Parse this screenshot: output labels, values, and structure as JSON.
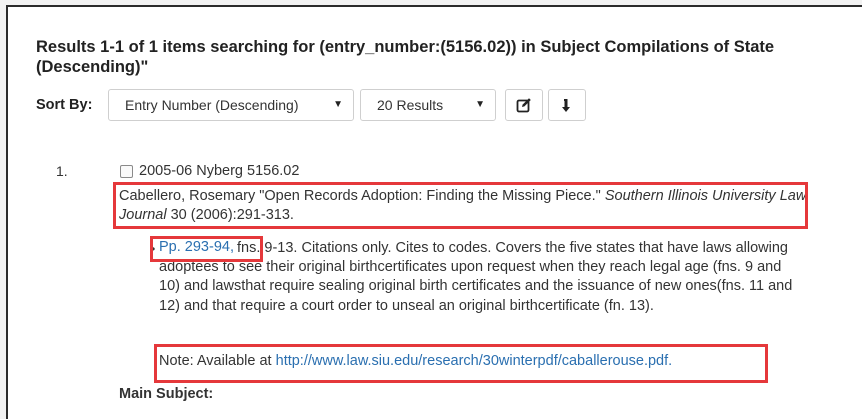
{
  "results": {
    "heading_line1": "Results 1-1 of 1 items searching for (entry_number:(5156.02)) in Subject Compilations of State",
    "heading_line2": "(Descending)\""
  },
  "toolbar": {
    "sort_label": "Sort By:",
    "sort_value": "Entry Number (Descending)",
    "count_value": "20 Results",
    "caret_glyph": "▼",
    "edit_icon": "edit-icon",
    "sort_icon": "sort-arrow-icon"
  },
  "entry": {
    "number": "1.",
    "title": "2005-06 Nyberg 5156.02",
    "citation_author": "Cabellero, Rosemary  \"Open Records Adoption: Finding the Missing Piece.\"  ",
    "citation_journal": "Southern Illinois University Law Journal",
    "citation_tail": "  30 (2006):291-313.",
    "pages": "Pp. 293-94,",
    "description": "fns. 9-13. Citations only. Cites to codes. Covers the five states that have laws allowing adoptees to see their original birthcertificates upon request when they reach legal age (fns. 9 and 10) and lawsthat require sealing original birth certificates and the issuance of new ones(fns. 11 and 12) and that require a court order to unseal an original birthcertificate (fn. 13).",
    "note_label": "Note: Available at ",
    "note_link": "http://www.law.siu.edu/research/30winterpdf/caballerouse.pdf.",
    "main_subject_label": "Main Subject:"
  },
  "colors": {
    "highlight": "#e5383b",
    "link": "#2a6fb0"
  }
}
